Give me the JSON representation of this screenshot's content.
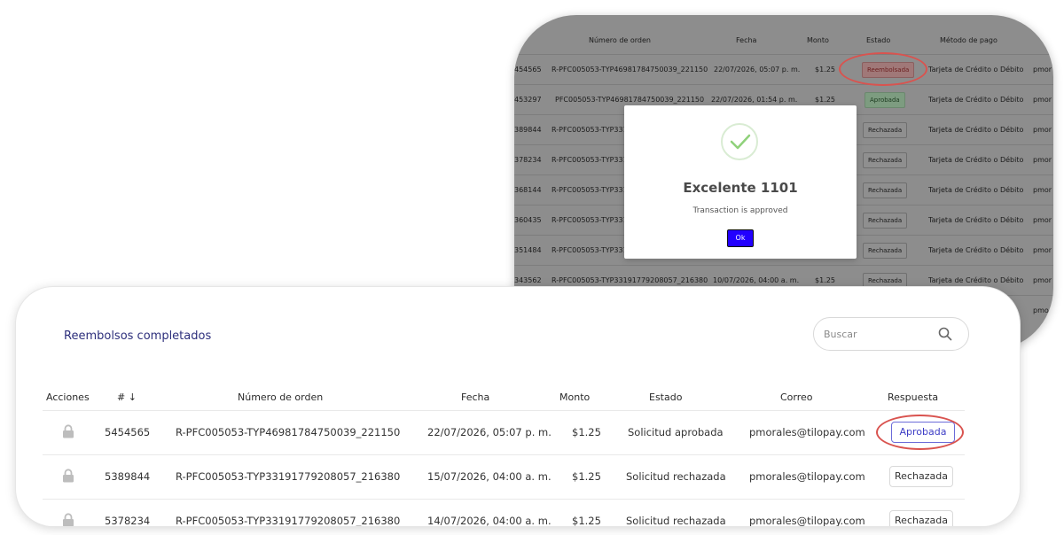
{
  "top_table": {
    "headers": [
      "Número de orden",
      "Fecha",
      "Monto",
      "Estado",
      "Método de pago"
    ],
    "rows": [
      {
        "id": "454565",
        "order": "R-PFC005053-TYP46981784750039_221150",
        "date": "22/07/2026, 05:07 p. m.",
        "amount": "$1.25",
        "status": "Reembolsada",
        "method": "Tarjeta de Crédito o Débito",
        "user": "pmor"
      },
      {
        "id": "453297",
        "order": "PFC005053-TYP46981784750039_221150",
        "date": "22/07/2026, 01:54 p. m.",
        "amount": "$1.25",
        "status": "Aprobada",
        "method": "Tarjeta de Crédito o Débito",
        "user": "pmor"
      },
      {
        "id": "389844",
        "order": "R-PFC005053-TYP3319",
        "date": "",
        "amount": "",
        "status": "Rechazada",
        "method": "Tarjeta de Crédito o Débito",
        "user": "pmor"
      },
      {
        "id": "378234",
        "order": "R-PFC005053-TYP3319",
        "date": "",
        "amount": "",
        "status": "Rechazada",
        "method": "Tarjeta de Crédito o Débito",
        "user": "pmor"
      },
      {
        "id": "368144",
        "order": "R-PFC005053-TYP3319",
        "date": "",
        "amount": "",
        "status": "Rechazada",
        "method": "Tarjeta de Crédito o Débito",
        "user": "pmor"
      },
      {
        "id": "360435",
        "order": "R-PFC005053-TYP3319",
        "date": "",
        "amount": "",
        "status": "Rechazada",
        "method": "Tarjeta de Crédito o Débito",
        "user": "pmor"
      },
      {
        "id": "351484",
        "order": "R-PFC005053-TYP3319",
        "date": "",
        "amount": "",
        "status": "Rechazada",
        "method": "Tarjeta de Crédito o Débito",
        "user": "pmor"
      },
      {
        "id": "343562",
        "order": "R-PFC005053-TYP33191779208057_216380",
        "date": "10/07/2026, 04:00 a. m.",
        "amount": "$1.25",
        "status": "Rechazada",
        "method": "Tarjeta de Crédito o Débito",
        "user": "pmor"
      }
    ],
    "last_user": "pmo"
  },
  "modal": {
    "title": "Excelente 1101",
    "message": "Transaction is approved",
    "ok_label": "Ok"
  },
  "refunds": {
    "title": "Reembolsos completados",
    "search_placeholder": "Buscar",
    "headers": {
      "actions": "Acciones",
      "num": "# ↓",
      "order": "Número de orden",
      "date": "Fecha",
      "amount": "Monto",
      "status": "Estado",
      "email": "Correo",
      "response": "Respuesta"
    },
    "rows": [
      {
        "num": "5454565",
        "order": "R-PFC005053-TYP46981784750039_221150",
        "date": "22/07/2026, 05:07 p. m.",
        "amount": "$1.25",
        "status": "Solicitud aprobada",
        "email": "pmorales@tilopay.com",
        "response": "Aprobada"
      },
      {
        "num": "5389844",
        "order": "R-PFC005053-TYP33191779208057_216380",
        "date": "15/07/2026, 04:00 a. m.",
        "amount": "$1.25",
        "status": "Solicitud rechazada",
        "email": "pmorales@tilopay.com",
        "response": "Rechazada"
      },
      {
        "num": "5378234",
        "order": "R-PFC005053-TYP33191779208057_216380",
        "date": "14/07/2026, 04:00 a. m.",
        "amount": "$1.25",
        "status": "Solicitud rechazada",
        "email": "pmorales@tilopay.com",
        "response": "Rechazada"
      }
    ]
  },
  "colors": {
    "accent": "#2d2f7c",
    "ok_button": "#2200ff",
    "highlight": "#d9534f"
  }
}
